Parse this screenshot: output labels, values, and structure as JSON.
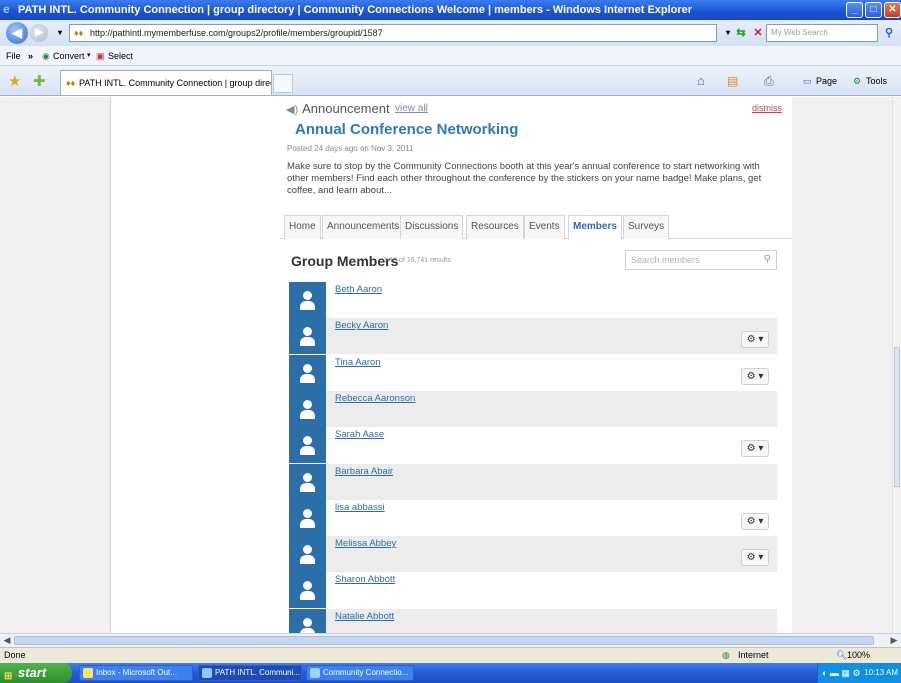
{
  "window": {
    "title": "PATH INTL. Community Connection | group directory | Community Connections Welcome | members - Windows Internet Explorer"
  },
  "browser": {
    "address": "http://pathintl.mymemberfuse.com/groups2/profile/members/groupid/1587",
    "search_placeholder": "My Web Search",
    "menu": {
      "file": "File",
      "convert": "Convert",
      "select": "Select"
    },
    "tab_title": "PATH INTL. Community Connection | group directory |...",
    "cmd": {
      "page": "Page",
      "tools": "Tools"
    }
  },
  "announcement": {
    "header": "Announcement",
    "view_all": "view all",
    "dismiss": "dismiss",
    "title": "Annual Conference Networking",
    "posted": "Posted 24 days ago on Nov 3, 2011",
    "body": "Make sure to stop by the Community Connections booth at this year's annual conference to start networking with other members! Find each other throughout the conference by the stickers on your name badge! Make plans, get coffee, and learn about..."
  },
  "tabs": [
    "Home",
    "Announcements",
    "Discussions",
    "Resources",
    "Events",
    "Members",
    "Surveys"
  ],
  "active_tab": "Members",
  "group_members": {
    "title": "Group Members",
    "count": "1-10 of 16,741 results",
    "search_placeholder": "Search members",
    "members": [
      {
        "name": "Beth Aaron",
        "gear": false
      },
      {
        "name": "Becky Aaron",
        "gear": true
      },
      {
        "name": "Tina Aaron",
        "gear": true
      },
      {
        "name": "Rebecca Aaronson",
        "gear": false
      },
      {
        "name": "Sarah Aase",
        "gear": true
      },
      {
        "name": "Barbara Abair",
        "gear": false
      },
      {
        "name": "lisa abbassi",
        "gear": true
      },
      {
        "name": "Melissa Abbey",
        "gear": true
      },
      {
        "name": "Sharon Abbott",
        "gear": false
      },
      {
        "name": "Natalie Abbott",
        "gear": false
      }
    ]
  },
  "status": {
    "left": "Done",
    "zone": "Internet",
    "zoom": "100%"
  },
  "taskbar": {
    "start": "start",
    "items": [
      "Inbox - Microsoft Out...",
      "PATH INTL. Communi...",
      "Community Connectio..."
    ],
    "clock": "10:13 AM"
  }
}
